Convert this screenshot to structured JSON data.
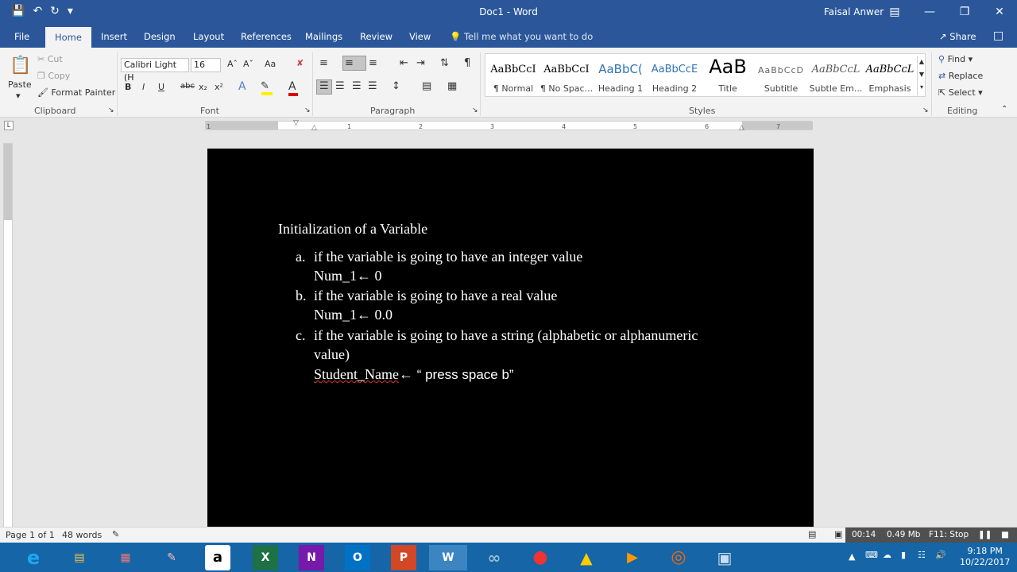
{
  "titlebar": {
    "doc_title": "Doc1  -  Word",
    "user": "Faisal Anwer"
  },
  "tabs": [
    "File",
    "Home",
    "Insert",
    "Design",
    "Layout",
    "References",
    "Mailings",
    "Review",
    "View"
  ],
  "tell_me": "Tell me what you want to do",
  "share": "Share",
  "clipboard": {
    "paste": "Paste",
    "cut": "Cut",
    "copy": "Copy",
    "format_painter": "Format Painter",
    "label": "Clipboard"
  },
  "font": {
    "name": "Calibri Light (H",
    "size": "16",
    "label": "Font",
    "bold": "B",
    "italic": "I",
    "underline": "U",
    "strike": "abc",
    "sub": "x₂",
    "sup": "x²",
    "grow": "Aˆ",
    "shrink": "Aˇ",
    "case": "Aa",
    "effects": "A",
    "color_a": "A"
  },
  "paragraph": {
    "label": "Paragraph",
    "pilcrow": "¶"
  },
  "styles": {
    "label": "Styles",
    "items": [
      {
        "preview": "AaBbCcI",
        "name": "¶ Normal"
      },
      {
        "preview": "AaBbCcI",
        "name": "¶ No Spac..."
      },
      {
        "preview": "AaBbC(",
        "name": "Heading 1"
      },
      {
        "preview": "AaBbCcE",
        "name": "Heading 2"
      },
      {
        "preview": "AaB",
        "name": "Title"
      },
      {
        "preview": "AaBbCcD",
        "name": "Subtitle"
      },
      {
        "preview": "AaBbCcL",
        "name": "Subtle Em..."
      },
      {
        "preview": "AaBbCcL",
        "name": "Emphasis"
      }
    ]
  },
  "editing": {
    "find": "Find",
    "replace": "Replace",
    "select": "Select",
    "label": "Editing"
  },
  "ruler_ticks": [
    "1",
    "1",
    "2",
    "3",
    "4",
    "5",
    "6",
    "7"
  ],
  "document": {
    "heading": "Initialization of a Variable",
    "a_marker": "a.",
    "a_text": "if the variable is going to have an integer value",
    "a_code": "Num_1← 0",
    "b_marker": "b.",
    "b_text": "if the variable is going to have a real value",
    "b_code": "Num_1← 0.0",
    "c_marker": "c.",
    "c_text_1": "if the variable is going to have a string (alphabetic or alphanumeric",
    "c_text_2": "value)",
    "c_code_name": "Student_Name",
    "c_code_arrow": "←",
    "c_code_rest": " “ press space b”"
  },
  "status": {
    "page": "Page 1 of 1",
    "words": "48 words"
  },
  "recorder": {
    "time": "00:14",
    "size": "0.49 Mb",
    "stop": "F11: Stop"
  },
  "tray": {
    "time": "9:18 PM",
    "date": "10/22/2017"
  },
  "taskbar_apps": [
    "e",
    "▤",
    "▦",
    "✎",
    "a",
    "X",
    "N",
    "O",
    "P",
    "W",
    "∞",
    "●",
    "▲",
    "▶",
    "◎",
    "▣"
  ]
}
